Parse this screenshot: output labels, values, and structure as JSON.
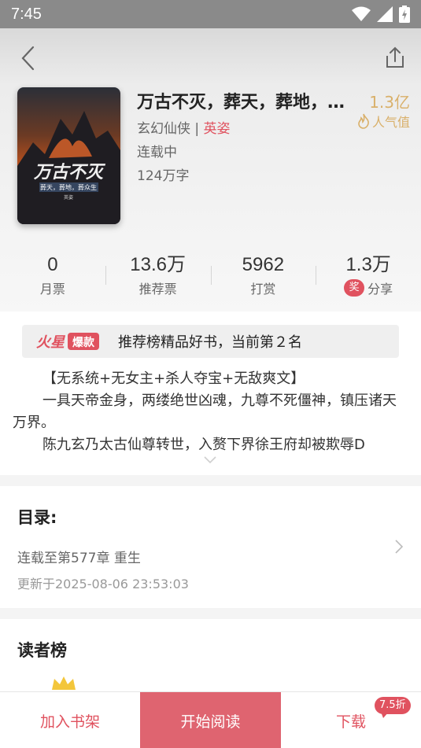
{
  "status_bar": {
    "time": "7:45"
  },
  "book": {
    "title": "万古不灭，葬天，葬地，葬众生",
    "genre": "玄幻仙侠",
    "separator": " | ",
    "author": "英姿",
    "status": "连载中",
    "word_count": "124万字",
    "popularity_value": "1.3亿",
    "popularity_label": "人气值",
    "cover": {
      "title_art": "万古不灭",
      "subtitle": "葬天，葬地，葬众生",
      "author": "英姿"
    }
  },
  "stats": [
    {
      "value": "0",
      "label": "月票"
    },
    {
      "value": "13.6万",
      "label": "推荐票"
    },
    {
      "value": "5962",
      "label": "打赏"
    },
    {
      "value": "1.3万",
      "label": "分享",
      "badge": "奖"
    }
  ],
  "rank_banner": {
    "logo_text_1": "火星",
    "logo_text_2": "爆款",
    "text": "推荐榜精品好书，当前第２名"
  },
  "synopsis": {
    "line_1": "【无系统+无女主+杀人夺宝+无敌爽文】",
    "line_2": "一具天帝金身，两缕绝世凶魂，九尊不死僵神，镇压诸天万界。",
    "line_3": "陈九玄乃太古仙尊转世，入赘下界徐王府却被欺辱D"
  },
  "catalog": {
    "title": "目录:",
    "latest": "连载至第577章 重生",
    "updated": "更新于2025-08-06 23:53:03"
  },
  "readers": {
    "title": "读者榜"
  },
  "bottom_bar": {
    "add_shelf": "加入书架",
    "start_read": "开始阅读",
    "download": "下载",
    "discount": "7.5折"
  },
  "colors": {
    "accent": "#e0525f",
    "read_button": "#df6470",
    "gold": "#d9b06a"
  }
}
